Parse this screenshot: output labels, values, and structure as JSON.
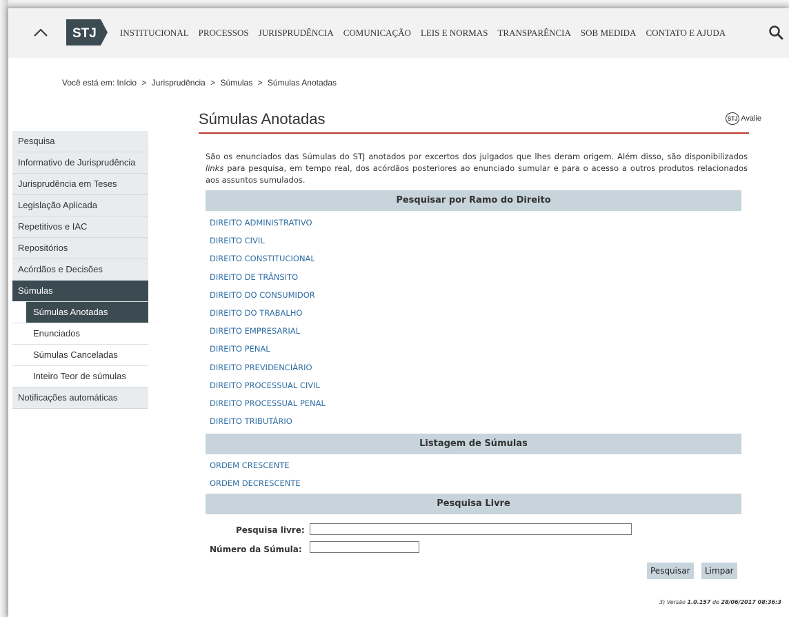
{
  "nav": {
    "logo": "STJ",
    "items": [
      "INSTITUCIONAL",
      "PROCESSOS",
      "JURISPRUDÊNCIA",
      "COMUNICAÇÃO",
      "LEIS E NORMAS",
      "TRANSPARÊNCIA",
      "SOB MEDIDA",
      "CONTATO E AJUDA"
    ],
    "search_icon": "search-icon",
    "collapse_icon": "chevron-up-icon"
  },
  "breadcrumb": {
    "prefix": "Você está em:",
    "items": [
      "Início",
      "Jurisprudência",
      "Súmulas",
      "Súmulas Anotadas"
    ],
    "separator": ">"
  },
  "page": {
    "title": "Súmulas Anotadas",
    "avalie_logo": "STJ",
    "avalie_label": "Avalie",
    "intro_part1": "São os enunciados das Súmulas do STJ anotados por excertos dos julgados que lhes deram origem. Além disso, são disponibilizados ",
    "intro_em": "links",
    "intro_part2": " para pesquisa, em tempo real, dos acórdãos posteriores ao enunciado sumular e para o acesso a outros produtos relacionados aos assuntos sumulados."
  },
  "sidebar": {
    "items": [
      {
        "label": "Pesquisa"
      },
      {
        "label": "Informativo de Jurisprudência"
      },
      {
        "label": "Jurisprudência em Teses"
      },
      {
        "label": "Legislação Aplicada"
      },
      {
        "label": "Repetitivos e IAC"
      },
      {
        "label": "Repositórios"
      },
      {
        "label": "Acórdãos e Decisões"
      },
      {
        "label": "Súmulas"
      },
      {
        "label": "Súmulas Anotadas"
      },
      {
        "label": "Enunciados"
      },
      {
        "label": "Súmulas Canceladas"
      },
      {
        "label": "Inteiro Teor de súmulas"
      },
      {
        "label": "Notificações automáticas"
      }
    ]
  },
  "sections": {
    "ramo": {
      "header": "Pesquisar por Ramo do Direito",
      "links": [
        "DIREITO ADMINISTRATIVO",
        "DIREITO CIVIL",
        "DIREITO CONSTITUCIONAL",
        "DIREITO DE TRÂNSITO",
        "DIREITO DO CONSUMIDOR",
        "DIREITO DO TRABALHO",
        "DIREITO EMPRESARIAL",
        "DIREITO PENAL",
        "DIREITO PREVIDENCIÁRIO",
        "DIREITO PROCESSUAL CIVIL",
        "DIREITO PROCESSUAL PENAL",
        "DIREITO TRIBUTÁRIO"
      ]
    },
    "listagem": {
      "header": "Listagem de Súmulas",
      "links": [
        "ORDEM CRESCENTE",
        "ORDEM DECRESCENTE"
      ]
    },
    "livre": {
      "header": "Pesquisa Livre",
      "label_pesquisa": "Pesquisa livre:",
      "value_pesquisa": "",
      "label_numero": "Número da Súmula:",
      "value_numero": "",
      "btn_pesquisar": "Pesquisar",
      "btn_limpar": "Limpar"
    }
  },
  "footer": {
    "version_prefix": "3) Versão ",
    "version": "1.0.157",
    "date_prefix": " de ",
    "date": "28/06/2017 08:36:3"
  },
  "colors": {
    "accent_rule": "#b83c2c",
    "section_bg": "#c8d4dc",
    "link": "#2e6da4",
    "sidebar_active": "#3c4b52"
  }
}
